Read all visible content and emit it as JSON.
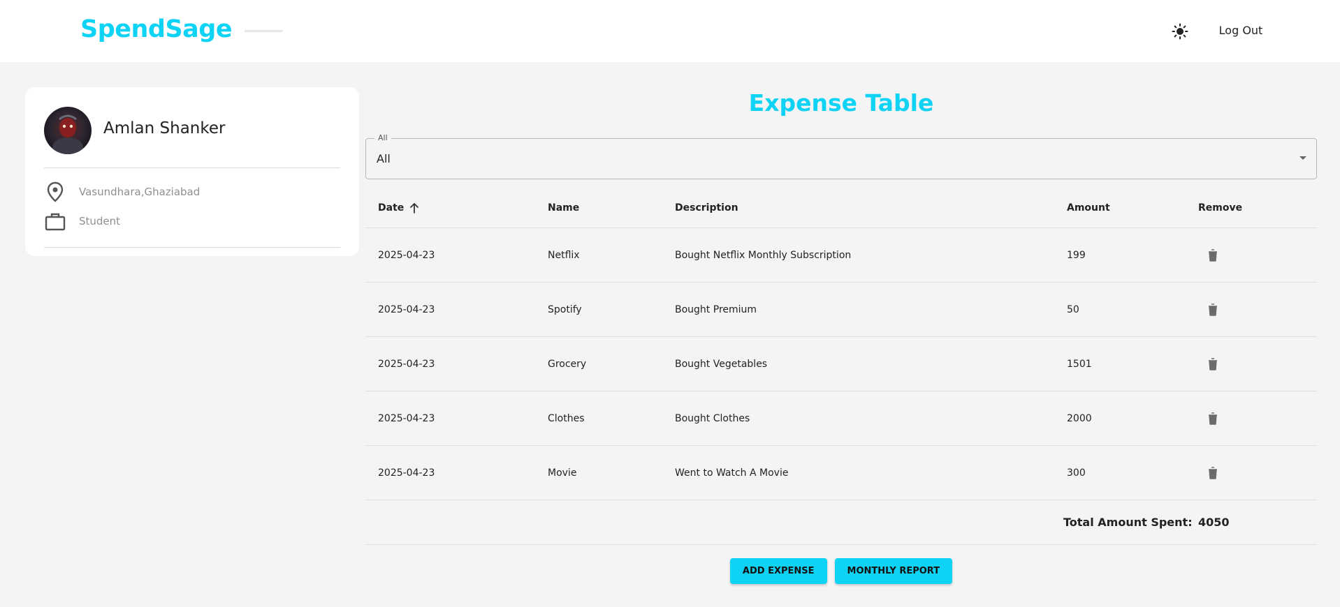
{
  "brand": {
    "name": "SpendSage",
    "accent_color": "#0fd3f5"
  },
  "header": {
    "theme_icon": "sun-icon",
    "logout_label": "Log Out"
  },
  "profile": {
    "name": "Amlan Shanker",
    "location": "Vasundhara,Ghaziabad",
    "occupation": "Student",
    "location_icon": "location-pin-icon",
    "occupation_icon": "briefcase-icon"
  },
  "main": {
    "title": "Expense Table",
    "filter": {
      "legend": "All",
      "value": "All"
    },
    "columns": {
      "date": "Date",
      "name": "Name",
      "description": "Description",
      "amount": "Amount",
      "remove": "Remove"
    },
    "rows": [
      {
        "date": "2025-04-23",
        "name": "Netflix",
        "description": "Bought Netflix Monthly Subscription",
        "amount": "199"
      },
      {
        "date": "2025-04-23",
        "name": "Spotify",
        "description": "Bought Premium",
        "amount": "50"
      },
      {
        "date": "2025-04-23",
        "name": "Grocery",
        "description": "Bought Vegetables",
        "amount": "1501"
      },
      {
        "date": "2025-04-23",
        "name": "Clothes",
        "description": "Bought Clothes",
        "amount": "2000"
      },
      {
        "date": "2025-04-23",
        "name": "Movie",
        "description": "Went to Watch A Movie",
        "amount": "300"
      }
    ],
    "total": {
      "label": "Total Amount Spent:",
      "value": "4050"
    },
    "actions": {
      "add_label": "ADD EXPENSE",
      "report_label": "MONTHLY REPORT"
    }
  }
}
